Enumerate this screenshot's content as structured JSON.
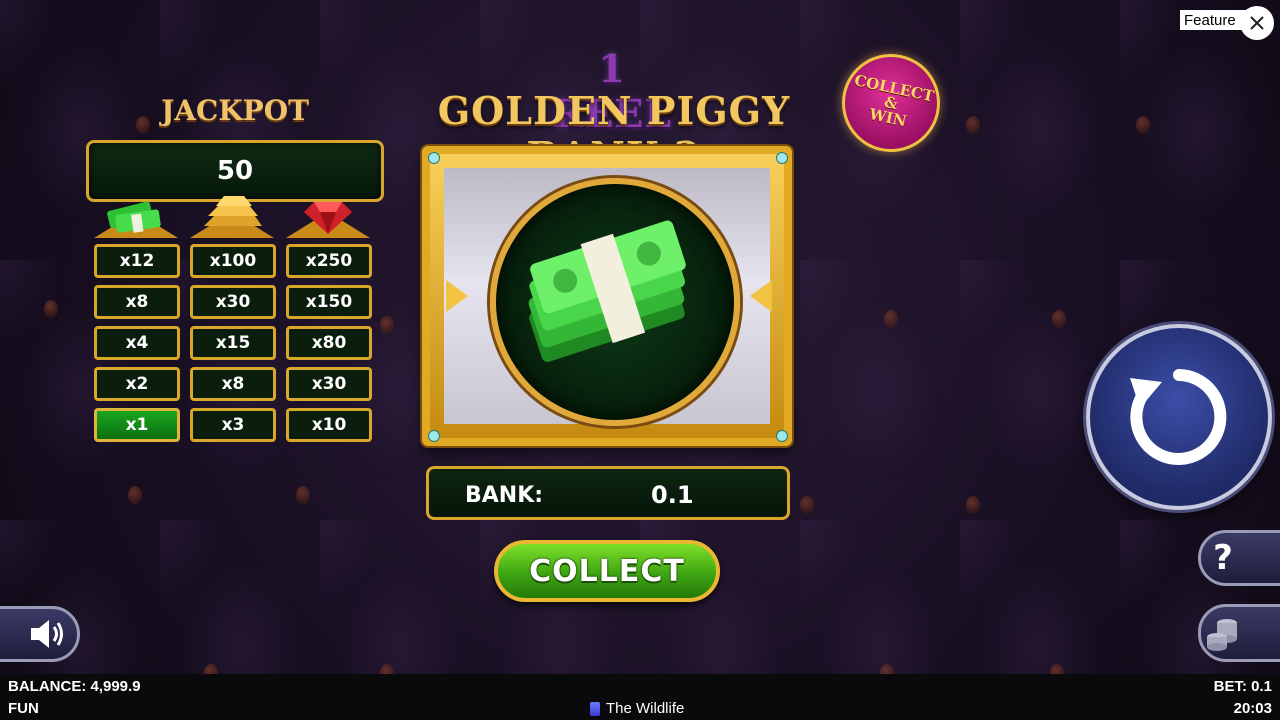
{
  "title": {
    "line1": "1 REEL",
    "line2": "GOLDEN PIGGY BANK 2"
  },
  "badge": {
    "line1": "COLLECT",
    "line2": "&",
    "line3": "WIN"
  },
  "jackpot": {
    "label": "JACKPOT",
    "value": "50"
  },
  "paytable": {
    "columns": [
      {
        "icon": "cash-stack-icon",
        "values": [
          "x12",
          "x8",
          "x4",
          "x2",
          "x1"
        ]
      },
      {
        "icon": "gold-bars-icon",
        "values": [
          "x100",
          "x30",
          "x15",
          "x8",
          "x3"
        ]
      },
      {
        "icon": "ruby-gem-icon",
        "values": [
          "x250",
          "x150",
          "x80",
          "x30",
          "x10"
        ]
      }
    ],
    "active": {
      "column": 0,
      "row": 4
    }
  },
  "reel": {
    "symbol": "cash-stack-icon"
  },
  "bank": {
    "label": "BANK:",
    "value": "0.1"
  },
  "collect_label": "COLLECT",
  "help_label": "?",
  "feature": {
    "label": "Feature"
  },
  "status": {
    "balance": "BALANCE: 4,999.9",
    "mode": "FUN",
    "brand": "The Wildlife",
    "bet": "BET: 0.1",
    "time": "20:03"
  },
  "colors": {
    "gold": "#d9a62c",
    "green": "#3ea612",
    "spin_blue": "#1f2a66",
    "badge_pink": "#e0309a"
  }
}
